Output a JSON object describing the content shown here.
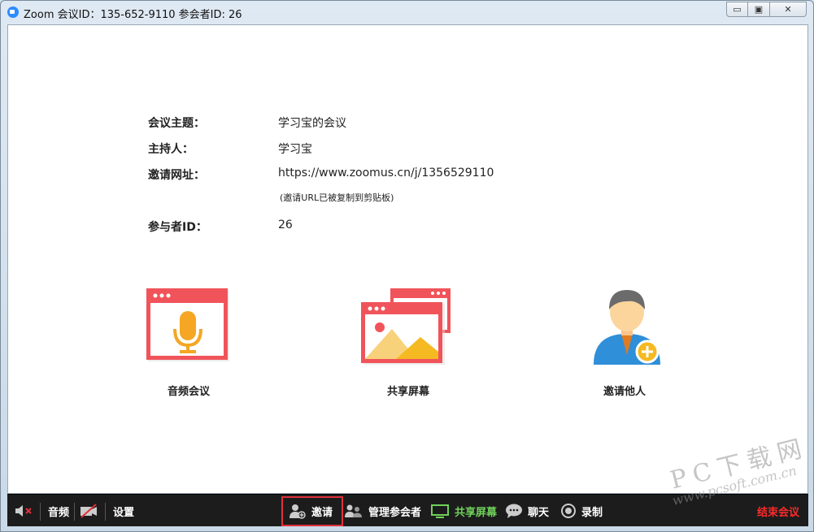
{
  "window": {
    "title": "Zoom 会议ID：135-652-9110 参会者ID: 26",
    "minimize_glyph": "▭",
    "maximize_glyph": "▣",
    "close_glyph": "✕"
  },
  "meeting_info": {
    "topic_label": "会议主题：",
    "topic_value": "学习宝的会议",
    "host_label": "主持人：",
    "host_value": "学习宝",
    "invite_url_label": "邀请网址：",
    "invite_url_value": "https://www.zoomus.cn/j/1356529110",
    "invite_url_note": "(邀请URL已被复制到剪贴板)",
    "participant_id_label": "参与者ID：",
    "participant_id_value": "26"
  },
  "actions": {
    "audio_label": "音频会议",
    "share_label": "共享屏幕",
    "invite_label": "邀请他人"
  },
  "toolbar": {
    "audio": "音频",
    "settings": "设置",
    "invite": "邀请",
    "manage_participants": "管理参会者",
    "share_screen": "共享屏幕",
    "chat": "聊天",
    "record": "录制",
    "end_meeting": "结束会议"
  },
  "watermark": {
    "big": "PC下载网",
    "small": "www.pcsoft.com.cn"
  },
  "colors": {
    "card_red": "#f0545a",
    "mic_orange": "#f5a623",
    "share_green": "#6fd15a",
    "end_red": "#ff2a2a",
    "avatar_blue": "#2f8fd8"
  }
}
